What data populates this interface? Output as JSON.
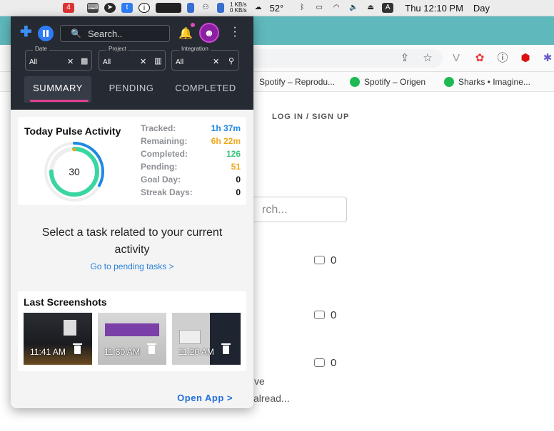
{
  "menubar": {
    "network_up": "1 KB/s",
    "network_down": "0 KB/s",
    "temperature": "52°",
    "input_source": "A",
    "clock": "Thu 12:10 PM",
    "extra": "Day"
  },
  "bookmarks": [
    {
      "label": "Spotify – Reprodu..."
    },
    {
      "label": "Spotify – Origen"
    },
    {
      "label": "Sharks • Imagine..."
    }
  ],
  "background_page": {
    "login_link": "LOG IN / SIGN UP",
    "search_placeholder": "rch...",
    "comment_counts": [
      "0",
      "0",
      "0"
    ],
    "snippet_fragment_1": "alread...",
    "snippet_fragment_2": "ve"
  },
  "popup": {
    "search_placeholder": "Search..",
    "avatar_glyph": "☻",
    "filters": [
      {
        "label": "Date",
        "value": "All",
        "icon": "calendar-icon"
      },
      {
        "label": "Project",
        "value": "All",
        "icon": "chart-icon"
      },
      {
        "label": "Integration",
        "value": "All",
        "icon": "plug-icon"
      }
    ],
    "tabs": [
      {
        "label": "SUMMARY",
        "active": true
      },
      {
        "label": "PENDING",
        "active": false
      },
      {
        "label": "COMPLETED",
        "active": false
      }
    ],
    "pulse": {
      "title": "Today Pulse Activity",
      "center_value": "30",
      "ring_fraction_outer": 0.33,
      "ring_fraction_inner": 0.75,
      "stats": [
        {
          "label": "Tracked:",
          "value": "1h 37m",
          "color": "#1e88e5"
        },
        {
          "label": "Remaining:",
          "value": "6h 22m",
          "color": "#f0a81c"
        },
        {
          "label": "Completed:",
          "value": "126",
          "color": "#3cc47c"
        },
        {
          "label": "Pending:",
          "value": "51",
          "color": "#f0a81c"
        },
        {
          "label": "Goal Day:",
          "value": "0",
          "color": "#111111"
        },
        {
          "label": "Streak Days:",
          "value": "0",
          "color": "#111111"
        }
      ]
    },
    "select_message": "Select a task related to your current activity",
    "go_pending_link": "Go to pending tasks >",
    "screenshots": {
      "title": "Last Screenshots",
      "items": [
        {
          "time": "11:41 AM"
        },
        {
          "time": "11:30 AM"
        },
        {
          "time": "11:20 AM"
        }
      ]
    },
    "open_app": "Open App >"
  },
  "colors": {
    "accent": "#2f7df6",
    "tab_underline": "#e0408f",
    "header_bg": "#262b33",
    "browser_tabstrip": "#5fb8bc"
  }
}
